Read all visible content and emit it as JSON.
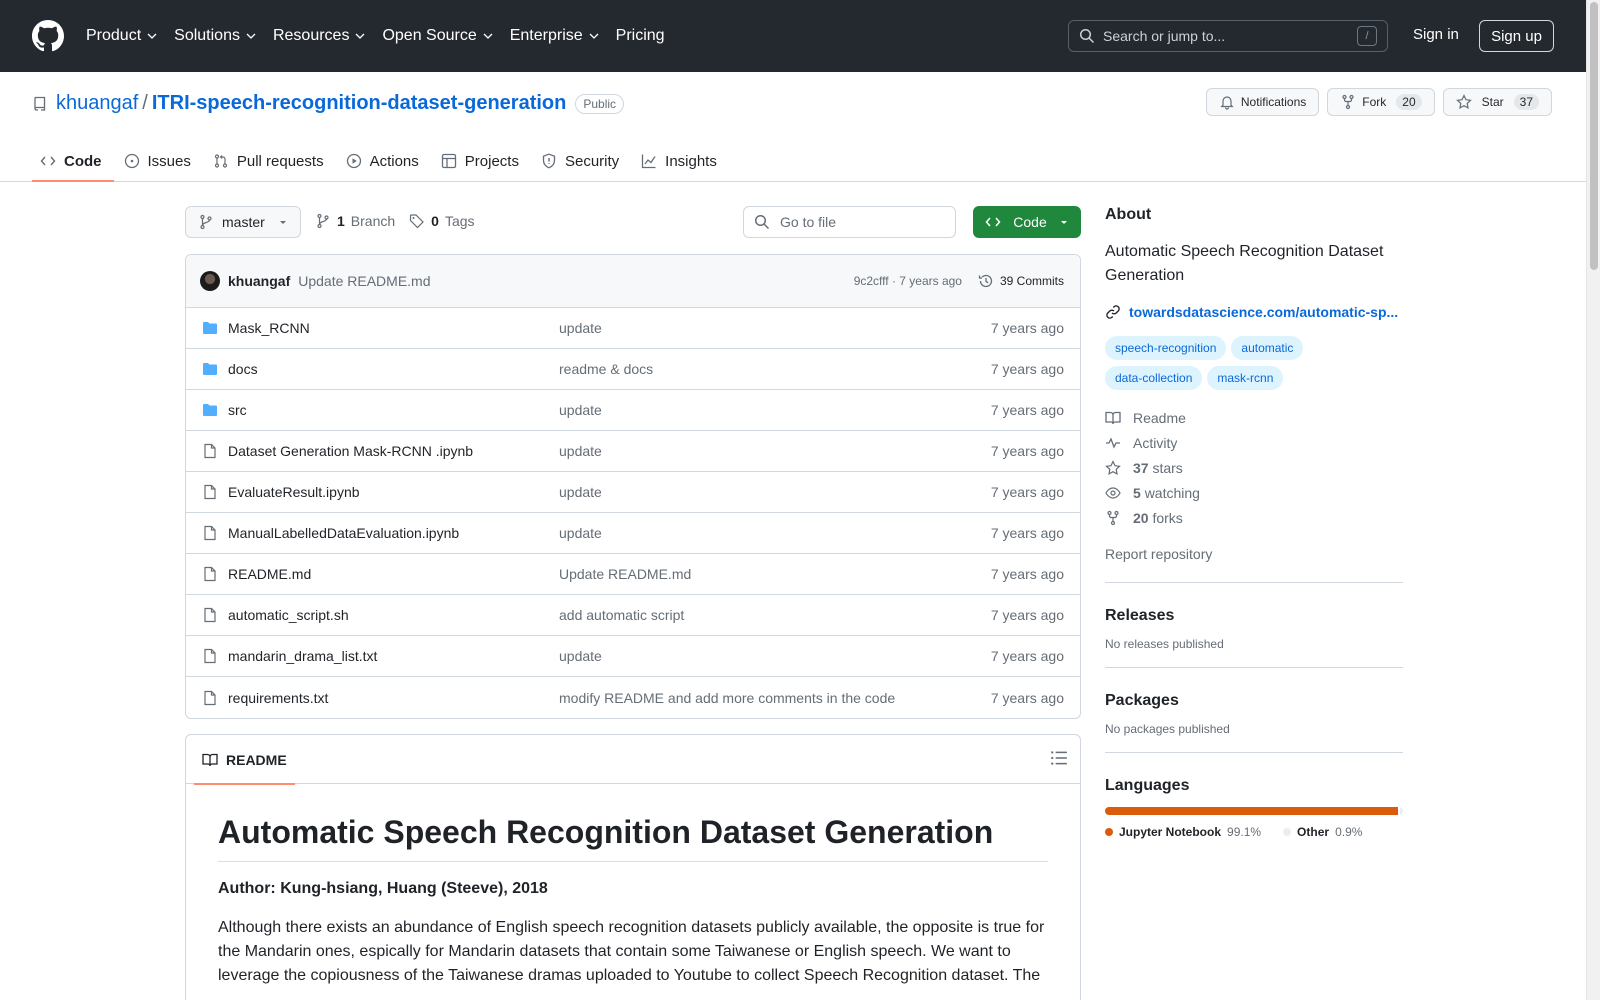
{
  "header": {
    "nav": [
      "Product",
      "Solutions",
      "Resources",
      "Open Source",
      "Enterprise",
      "Pricing"
    ],
    "search_placeholder": "Search or jump to...",
    "search_key": "/",
    "signin": "Sign in",
    "signup": "Sign up"
  },
  "repo": {
    "owner": "khuangaf",
    "separator": "/",
    "name": "ITRI-speech-recognition-dataset-generation",
    "visibility": "Public",
    "notifications_label": "Notifications",
    "fork_label": "Fork",
    "fork_count": "20",
    "star_label": "Star",
    "star_count": "37"
  },
  "tabs": [
    "Code",
    "Issues",
    "Pull requests",
    "Actions",
    "Projects",
    "Security",
    "Insights"
  ],
  "toolbar": {
    "branch": "master",
    "branch_count": "1",
    "branch_label": "Branch",
    "tag_count": "0",
    "tag_label": "Tags",
    "goto_placeholder": "Go to file",
    "code_label": "Code"
  },
  "commit": {
    "author": "khuangaf",
    "message": "Update README.md",
    "meta": "9c2cfff · 7 years ago",
    "commits_label": "39 Commits"
  },
  "files": [
    {
      "name": "Mask_RCNN",
      "type": "folder",
      "message": "update",
      "time": "7 years ago"
    },
    {
      "name": "docs",
      "type": "folder",
      "message": "readme & docs",
      "time": "7 years ago"
    },
    {
      "name": "src",
      "type": "folder",
      "message": "update",
      "time": "7 years ago"
    },
    {
      "name": "Dataset Generation Mask-RCNN .ipynb",
      "type": "file",
      "message": "update",
      "time": "7 years ago"
    },
    {
      "name": "EvaluateResult.ipynb",
      "type": "file",
      "message": "update",
      "time": "7 years ago"
    },
    {
      "name": "ManualLabelledDataEvaluation.ipynb",
      "type": "file",
      "message": "update",
      "time": "7 years ago"
    },
    {
      "name": "README.md",
      "type": "file",
      "message": "Update README.md",
      "time": "7 years ago"
    },
    {
      "name": "automatic_script.sh",
      "type": "file",
      "message": "add automatic script",
      "time": "7 years ago"
    },
    {
      "name": "mandarin_drama_list.txt",
      "type": "file",
      "message": "update",
      "time": "7 years ago"
    },
    {
      "name": "requirements.txt",
      "type": "file",
      "message": "modify README and add more comments in the code",
      "time": "7 years ago"
    }
  ],
  "readme": {
    "tab_label": "README",
    "title": "Automatic Speech Recognition Dataset Generation",
    "author_line": "Author: Kung-hsiang, Huang (Steeve), 2018",
    "paragraph": "Although there exists an abundance of English speech recognition datasets publicly available, the opposite is true for the Mandarin ones, espically for Mandarin datasets that contain some Taiwanese or English speech. We want to leverage the copiousness of the Taiwanese dramas uploaded to Youtube to collect Speech Recognition dataset. The"
  },
  "about": {
    "heading": "About",
    "description": "Automatic Speech Recognition Dataset Generation",
    "link": "towardsdatascience.com/automatic-sp...",
    "topics": [
      "speech-recognition",
      "automatic",
      "data-collection",
      "mask-rcnn"
    ],
    "readme": "Readme",
    "activity": "Activity",
    "stars_count": "37",
    "stars_label": "stars",
    "watching_count": "5",
    "watching_label": "watching",
    "forks_count": "20",
    "forks_label": "forks",
    "report": "Report repository"
  },
  "releases": {
    "heading": "Releases",
    "text": "No releases published"
  },
  "packages": {
    "heading": "Packages",
    "text": "No packages published"
  },
  "languages": {
    "heading": "Languages",
    "items": [
      {
        "name": "Jupyter Notebook",
        "percent": "99.1%",
        "color": "#DA5B0B",
        "fraction": 0.991
      },
      {
        "name": "Other",
        "percent": "0.9%",
        "color": "#EDEDED",
        "fraction": 0.009
      }
    ]
  }
}
